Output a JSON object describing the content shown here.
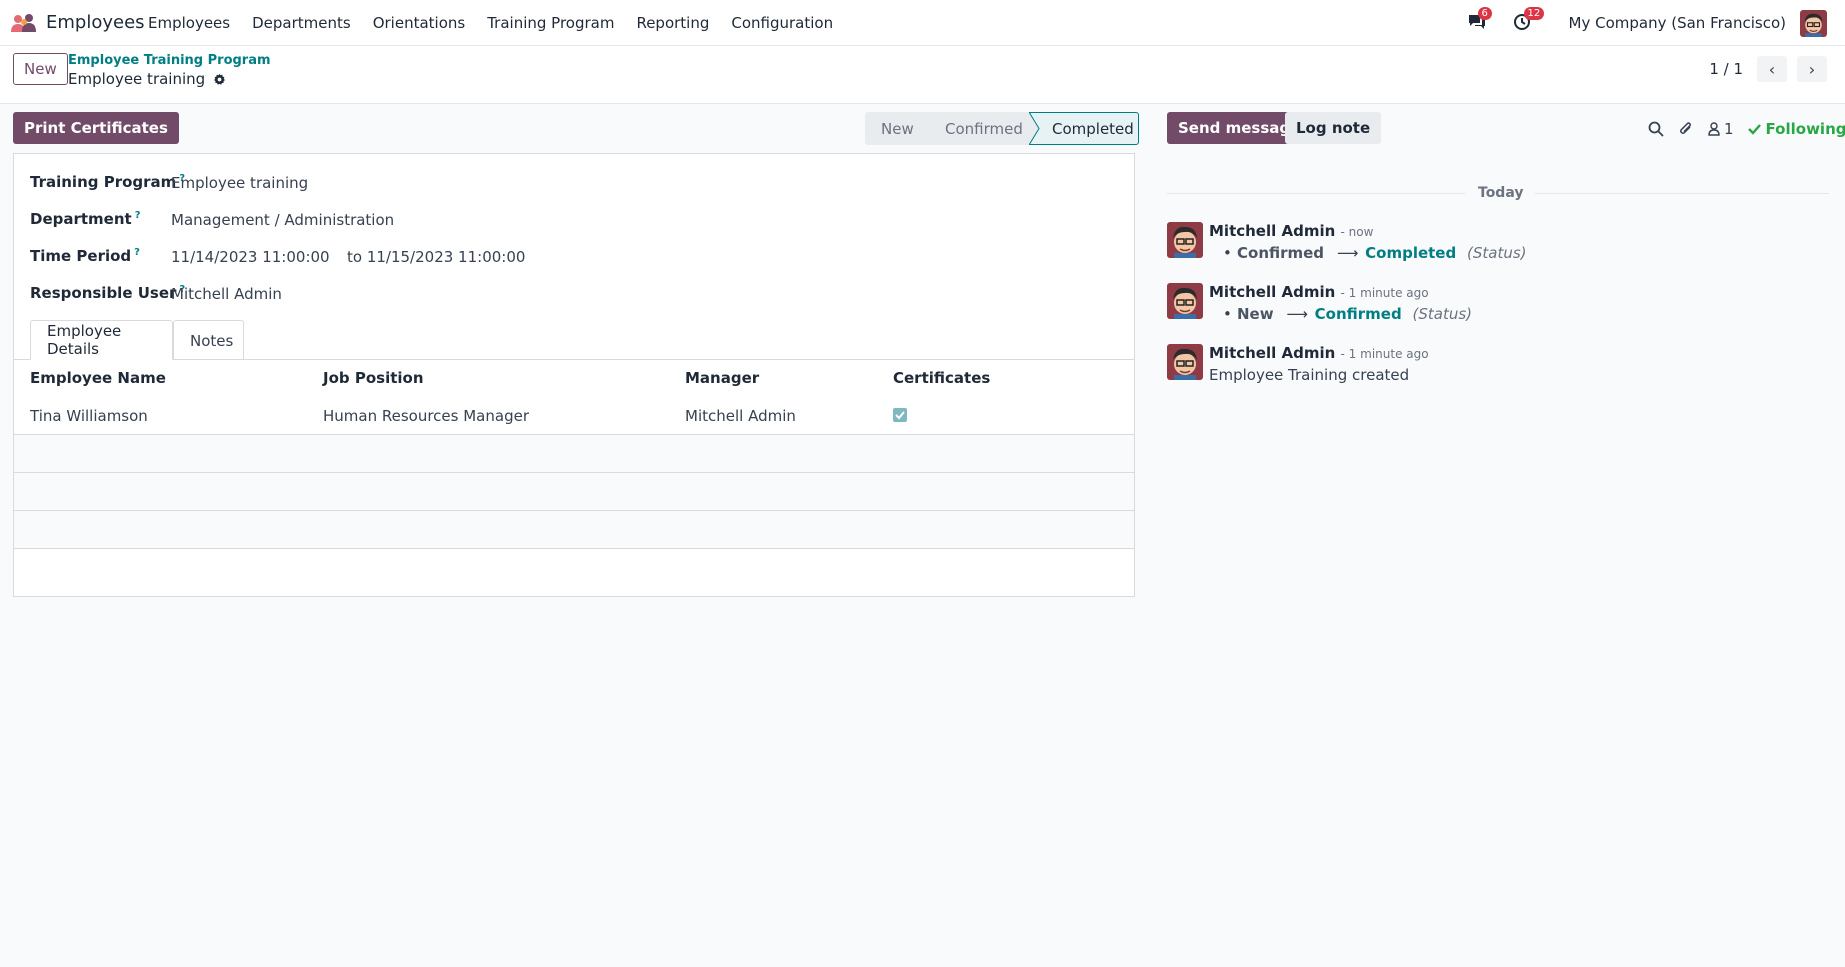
{
  "navbar": {
    "app_name": "Employees",
    "menu": [
      "Employees",
      "Departments",
      "Orientations",
      "Training Program",
      "Reporting",
      "Configuration"
    ],
    "messages_badge": "6",
    "activities_badge": "12",
    "company": "My Company (San Francisco)"
  },
  "control": {
    "new_label": "New",
    "breadcrumb_parent": "Employee Training Program",
    "breadcrumb_current": "Employee training",
    "pager": "1 / 1"
  },
  "actions": {
    "print_label": "Print Certificates"
  },
  "statusbar": {
    "stages": [
      "New",
      "Confirmed",
      "Completed"
    ],
    "current": "Completed"
  },
  "form": {
    "training_program_label": "Training Program",
    "training_program_value": "Employee training",
    "department_label": "Department",
    "department_value": "Management / Administration",
    "time_period_label": "Time Period",
    "time_start": "11/14/2023 11:00:00",
    "time_end": "to 11/15/2023 11:00:00",
    "responsible_label": "Responsible User",
    "responsible_value": "Mitchell Admin",
    "help_mark": "?"
  },
  "tabs": [
    "Employee Details",
    "Notes"
  ],
  "table": {
    "headers": [
      "Employee Name",
      "Job Position",
      "Manager",
      "Certificates"
    ],
    "rows": [
      {
        "employee": "Tina Williamson",
        "job": "Human Resources Manager",
        "manager": "Mitchell Admin",
        "certificate": true
      }
    ]
  },
  "chatter": {
    "send_message": "Send message",
    "log_note": "Log note",
    "followers_count": "1",
    "following_label": "Following",
    "day_separator": "Today",
    "messages": [
      {
        "author": "Mitchell Admin",
        "date": "- now",
        "old": "Confirmed",
        "new": "Completed",
        "field": "(Status)"
      },
      {
        "author": "Mitchell Admin",
        "date": "- 1 minute ago",
        "old": "New",
        "new": "Confirmed",
        "field": "(Status)"
      },
      {
        "author": "Mitchell Admin",
        "date": "- 1 minute ago",
        "body": "Employee Training created"
      }
    ],
    "arrow": "⟶"
  },
  "colors": {
    "primary": "#714b67",
    "link": "#017e84",
    "success": "#28a745",
    "badge": "#dc3545"
  }
}
